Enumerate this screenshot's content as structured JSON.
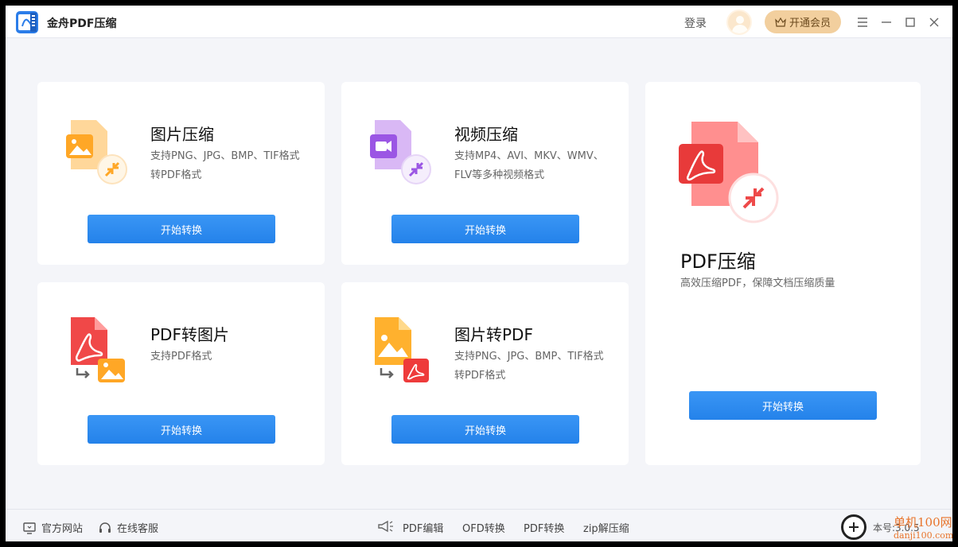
{
  "titlebar": {
    "app_title": "金舟PDF压缩",
    "login_label": "登录",
    "vip_label": "开通会员"
  },
  "cards": [
    {
      "title": "图片压缩",
      "desc": "支持PNG、JPG、BMP、TIF格式转PDF格式",
      "button": "开始转换",
      "icon": "image-compress-icon"
    },
    {
      "title": "视频压缩",
      "desc": "支持MP4、AVI、MKV、WMV、FLV等多种视频格式",
      "button": "开始转换",
      "icon": "video-compress-icon"
    },
    {
      "title": "PDF压缩",
      "desc": "高效压缩PDF，保障文档压缩质量",
      "button": "开始转换",
      "icon": "pdf-compress-icon"
    },
    {
      "title": "PDF转图片",
      "desc": "支持PDF格式",
      "button": "开始转换",
      "icon": "pdf-to-image-icon"
    },
    {
      "title": "图片转PDF",
      "desc": "支持PNG、JPG、BMP、TIF格式转PDF格式",
      "button": "开始转换",
      "icon": "image-to-pdf-icon"
    }
  ],
  "bottombar": {
    "official_site": "官方网站",
    "online_service": "在线客服",
    "links": [
      "PDF编辑",
      "OFD转换",
      "PDF转换",
      "zip解压缩"
    ],
    "version_partial": "本号:3.0.5",
    "watermark_line1": "单机100网",
    "watermark_line2": "danji100.com"
  },
  "colors": {
    "accent": "#2b8af0",
    "vip": "#f2cf9e",
    "background": "#f4f5f9"
  }
}
